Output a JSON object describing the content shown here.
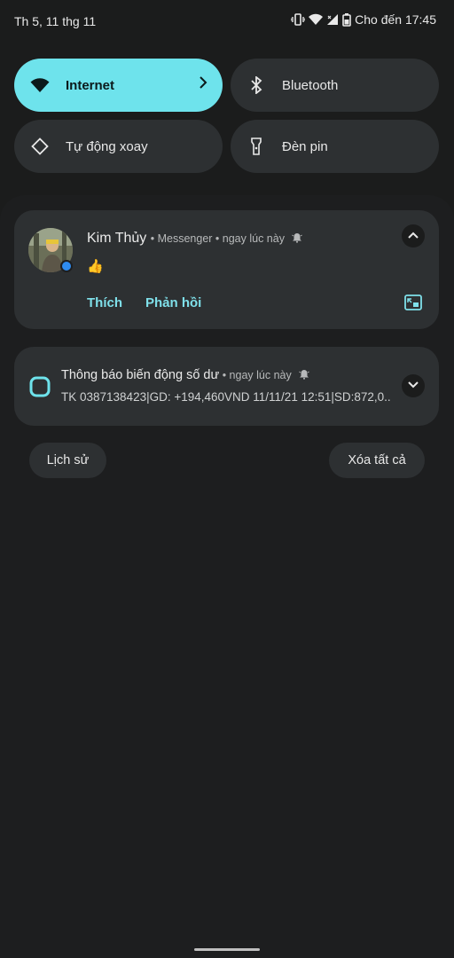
{
  "status_bar": {
    "date": "Th 5, 11 thg 11",
    "charge_text": "Cho đến 17:45"
  },
  "quick_settings": {
    "tiles": [
      {
        "label": "Internet",
        "active": true
      },
      {
        "label": "Bluetooth",
        "active": false
      },
      {
        "label": "Tự động xoay",
        "active": false
      },
      {
        "label": "Đèn pin",
        "active": false
      }
    ]
  },
  "notifications": {
    "messenger": {
      "sender": "Kim Thủy",
      "app": "Messenger",
      "time": "ngay lúc này",
      "message": "👍",
      "actions": [
        "Thích",
        "Phản hồi"
      ]
    },
    "bank": {
      "title": "Thông báo biến động số dư",
      "time": "ngay lúc này",
      "body": "TK 0387138423|GD: +194,460VND 11/11/21 12:51|SD:872,0.."
    }
  },
  "footer": {
    "history_label": "Lịch sử",
    "clear_all_label": "Xóa tất cả"
  },
  "colors": {
    "accent": "#6ee3ec",
    "tile_bg": "#2d3032",
    "background": "#1b1c1c"
  }
}
